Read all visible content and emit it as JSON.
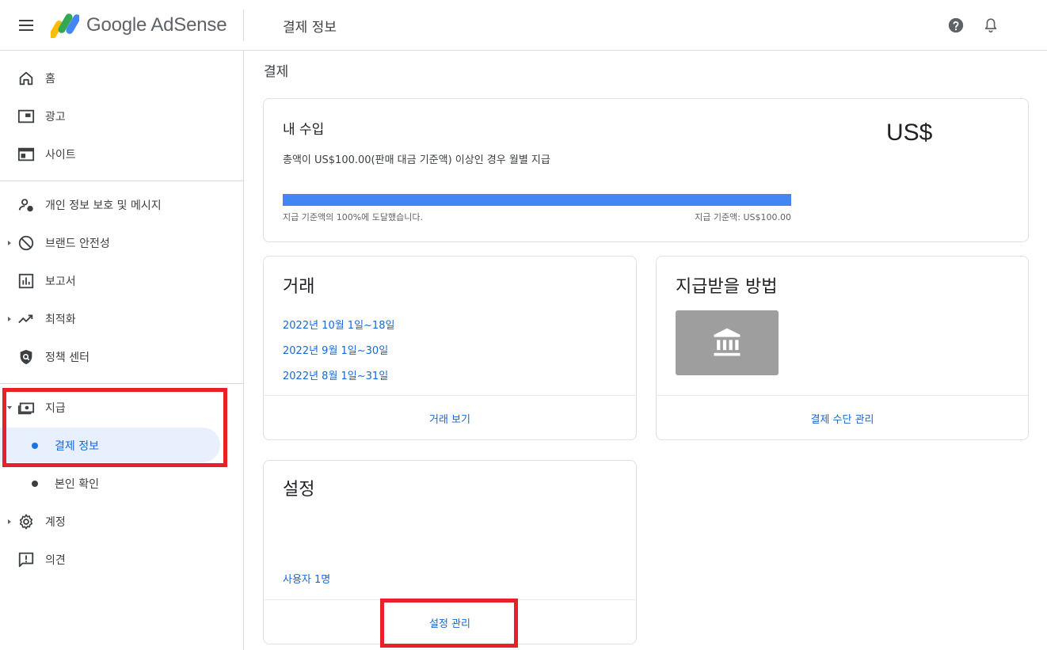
{
  "header": {
    "app_name": "Google AdSense",
    "page_title": "결제 정보",
    "icons": [
      "menu-icon",
      "help-icon",
      "bell-icon"
    ]
  },
  "sidebar": {
    "items": [
      {
        "label": "홈",
        "icon": "home-icon"
      },
      {
        "label": "광고",
        "icon": "ads-icon"
      },
      {
        "label": "사이트",
        "icon": "sites-icon"
      },
      {
        "label": "개인 정보 보호 및 메시지",
        "icon": "privacy-icon"
      },
      {
        "label": "브랜드 안전성",
        "icon": "block-icon"
      },
      {
        "label": "보고서",
        "icon": "reports-icon"
      },
      {
        "label": "최적화",
        "icon": "trending-icon"
      },
      {
        "label": "정책 센터",
        "icon": "policy-shield-icon"
      },
      {
        "label": "지급",
        "icon": "payments-icon"
      },
      {
        "label": "계정",
        "icon": "gear-icon"
      },
      {
        "label": "의견",
        "icon": "feedback-icon"
      }
    ],
    "payments_sub": [
      {
        "label": "결제 정보",
        "active": true
      },
      {
        "label": "본인 확인",
        "active": false
      }
    ]
  },
  "main": {
    "heading": "결제",
    "earnings": {
      "title": "내 수입",
      "amount": "US$",
      "description": "총액이 US$100.00(판매 대금 기준액) 이상인 경우 월별 지급",
      "progress_percent": 100,
      "progress_left": "지급 기준액의 100%에 도달했습니다.",
      "progress_right": "지급 기준액: US$100.00",
      "accent_color": "#4285f4"
    },
    "transactions": {
      "title": "거래",
      "periods": [
        "2022년 10월 1일~18일",
        "2022년 9월 1일~30일",
        "2022년 8월 1일~31일"
      ],
      "footer_link": "거래 보기"
    },
    "payment_method": {
      "title": "지급받을 방법",
      "icon": "bank-icon",
      "footer_link": "결제 수단 관리"
    },
    "settings": {
      "title": "설정",
      "users_link": "사용자 1명",
      "footer_link": "설정 관리"
    }
  }
}
